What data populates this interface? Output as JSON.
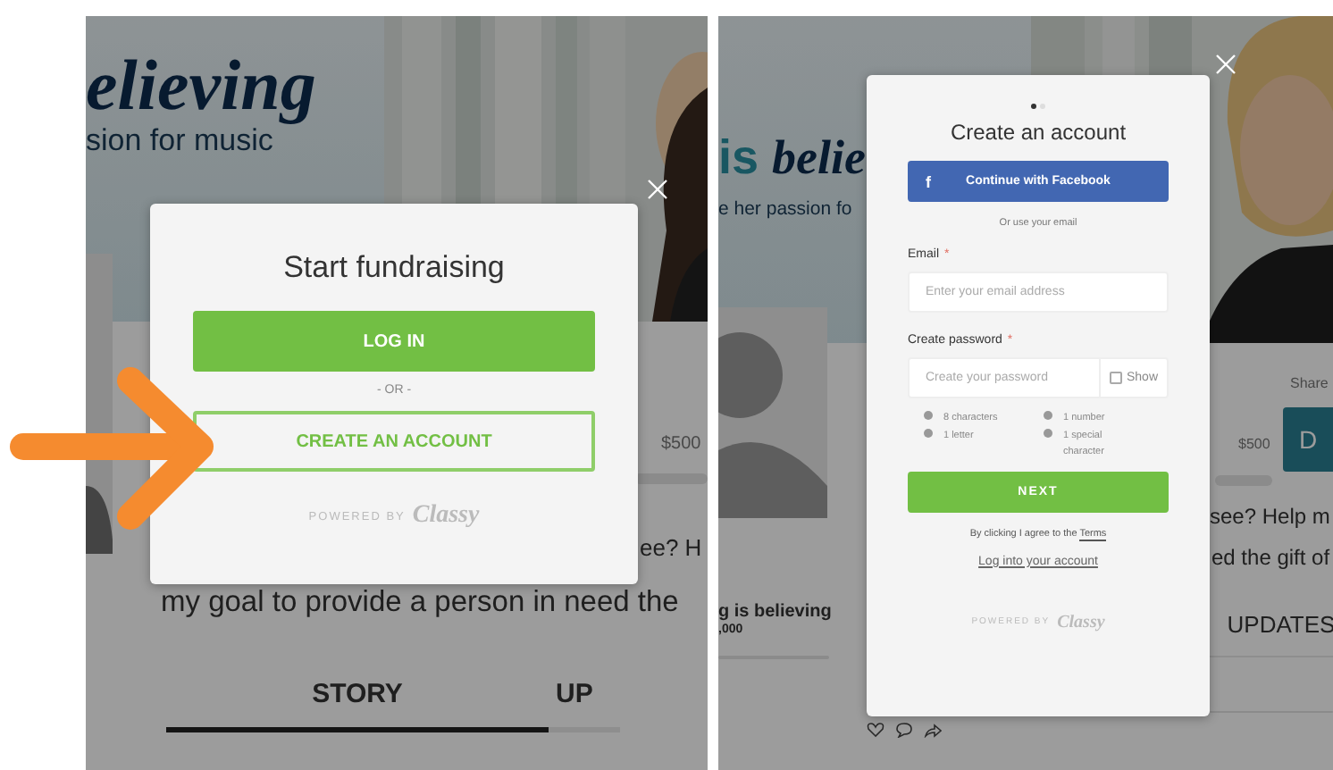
{
  "left_screen": {
    "hero": {
      "title_parts": [
        {
          "text": "elieving",
          "kind": "plain"
        }
      ],
      "subtitle": "sion for music"
    },
    "goal": "$500",
    "story_lines": [
      "ee? H",
      "my goal to provide a person in need the"
    ],
    "tabs": [
      {
        "label": "STORY",
        "selected": true
      },
      {
        "label": "UP",
        "selected": false
      }
    ],
    "modal": {
      "title": "Start fundraising",
      "primary_button": "LOG IN",
      "separator": "- OR -",
      "secondary_button": "CREATE AN ACCOUNT",
      "powered_by": "POWERED BY",
      "brand": "Classy"
    }
  },
  "right_screen": {
    "hero": {
      "title_parts": [
        {
          "text": "is",
          "kind": "accent"
        },
        {
          "text": "belie",
          "kind": "plain"
        }
      ],
      "subtitle": "e her passion fo"
    },
    "share": "Share",
    "goal": "$500",
    "donate_button": "D",
    "story_lines": [
      "see? Help m",
      "ed the gift of"
    ],
    "campaign": {
      "name": "g is believing",
      "raised": ",000"
    },
    "tabs": [
      {
        "label": "UPDATES",
        "selected": false
      }
    ],
    "modal": {
      "steps": [
        {
          "selected": true
        },
        {
          "selected": false
        }
      ],
      "title": "Create an account",
      "facebook_button": {
        "icon": "f",
        "label": "Continue with Facebook"
      },
      "divider": "Or use your email",
      "email": {
        "label": "Email",
        "required_mark": "*",
        "placeholder": "Enter your email address"
      },
      "password": {
        "label": "Create password",
        "required_mark": "*",
        "placeholder": "Create your password",
        "show": {
          "label": "Show",
          "checked": false
        }
      },
      "requirements": [
        {
          "text": "8 characters",
          "met": false
        },
        {
          "text": "1 number",
          "met": false
        },
        {
          "text": "1 letter",
          "met": false
        },
        {
          "text": "1 special character",
          "met": false
        }
      ],
      "next_button": "NEXT",
      "terms": {
        "text": "By clicking I agree to the",
        "link": "Terms"
      },
      "login_link": "Log into your account",
      "powered_by": "POWERED BY",
      "brand": "Classy"
    }
  }
}
